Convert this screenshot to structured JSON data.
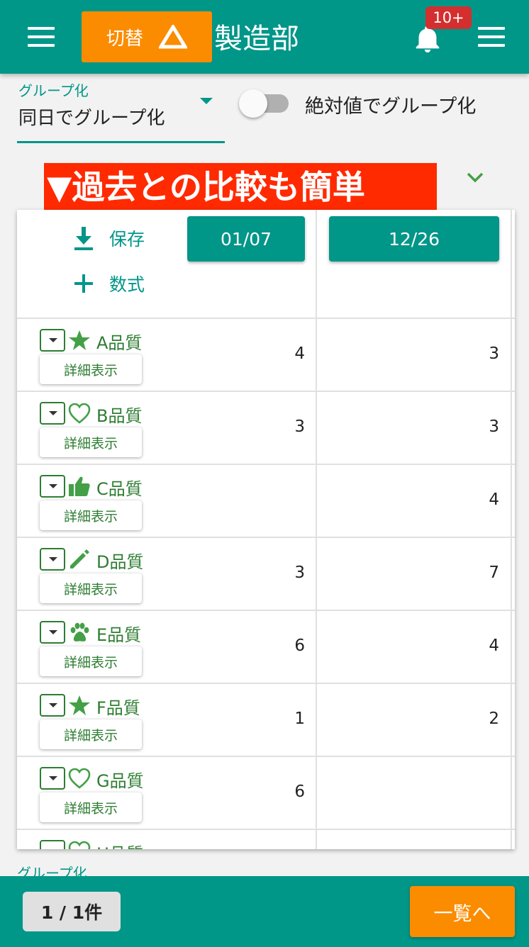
{
  "header": {
    "switch_label": "切替",
    "title": "製造部",
    "notification_badge": "10+"
  },
  "grouping": {
    "label": "グループ化",
    "value": "同日でグループ化",
    "toggle_label": "絶対値でグループ化",
    "toggle_on": false
  },
  "banner": {
    "text": "▼過去との比較も簡単"
  },
  "table": {
    "menu": {
      "save_label": "保存",
      "formula_label": "数式"
    },
    "columns": [
      "01/07",
      "12/26"
    ],
    "detail_label": "詳細表示",
    "rows": [
      {
        "name": "A品質",
        "icon": "star-icon",
        "values": [
          "4",
          "3"
        ]
      },
      {
        "name": "B品質",
        "icon": "heart-icon",
        "values": [
          "3",
          "3"
        ]
      },
      {
        "name": "C品質",
        "icon": "thumbs-up-icon",
        "values": [
          "",
          "4"
        ]
      },
      {
        "name": "D品質",
        "icon": "pencil-icon",
        "values": [
          "3",
          "7"
        ]
      },
      {
        "name": "E品質",
        "icon": "paw-icon",
        "values": [
          "6",
          "4"
        ]
      },
      {
        "name": "F品質",
        "icon": "star-icon",
        "values": [
          "1",
          "2"
        ]
      },
      {
        "name": "G品質",
        "icon": "heart-icon",
        "values": [
          "6",
          ""
        ]
      },
      {
        "name": "H品質",
        "icon": "heart-icon",
        "values": [
          "",
          ""
        ]
      }
    ]
  },
  "footer": {
    "grouping_hint": "グループ化",
    "count": "1 / 1件",
    "list_button": "一覧へ"
  },
  "colors": {
    "primary": "#009688",
    "accent": "#fb8c00",
    "badge": "#d32f2f",
    "banner": "#ff2a00",
    "row_text": "#2e7d32"
  }
}
